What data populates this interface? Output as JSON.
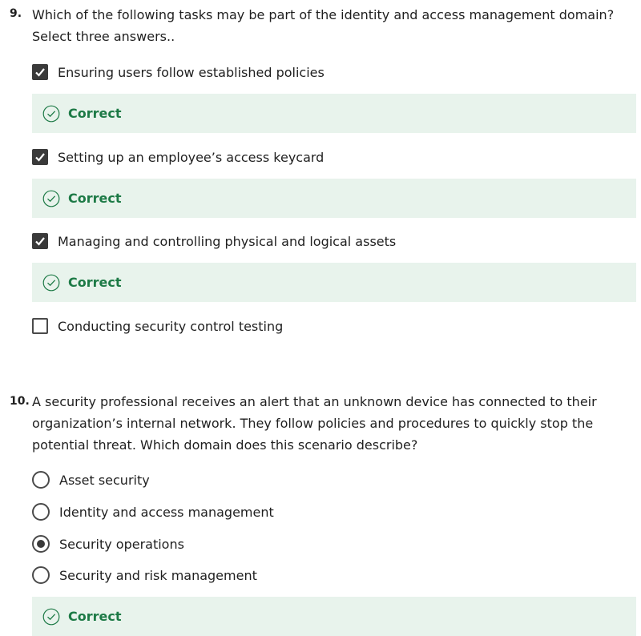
{
  "colors": {
    "correct_green": "#1d7a46",
    "feedback_bg": "#e8f3ec",
    "control_dark": "#3a3a3a"
  },
  "q9": {
    "number": "9.",
    "text": "Which of the following tasks may be part of the identity and access management domain? Select three answers..",
    "options": [
      {
        "label": "Ensuring users follow established policies",
        "checked": true,
        "feedback": "Correct"
      },
      {
        "label": "Setting up an employee’s access keycard",
        "checked": true,
        "feedback": "Correct"
      },
      {
        "label": "Managing and controlling physical and logical assets",
        "checked": true,
        "feedback": "Correct"
      },
      {
        "label": "Conducting security control testing",
        "checked": false
      }
    ]
  },
  "q10": {
    "number": "10.",
    "text": "A security professional receives an alert that an unknown device has connected to their organization’s internal network. They follow policies and procedures to quickly stop the potential threat. Which domain does this scenario describe?",
    "options": [
      {
        "label": "Asset security",
        "selected": false
      },
      {
        "label": "Identity and access management",
        "selected": false
      },
      {
        "label": "Security operations",
        "selected": true
      },
      {
        "label": "Security and risk management",
        "selected": false
      }
    ],
    "feedback": "Correct"
  }
}
